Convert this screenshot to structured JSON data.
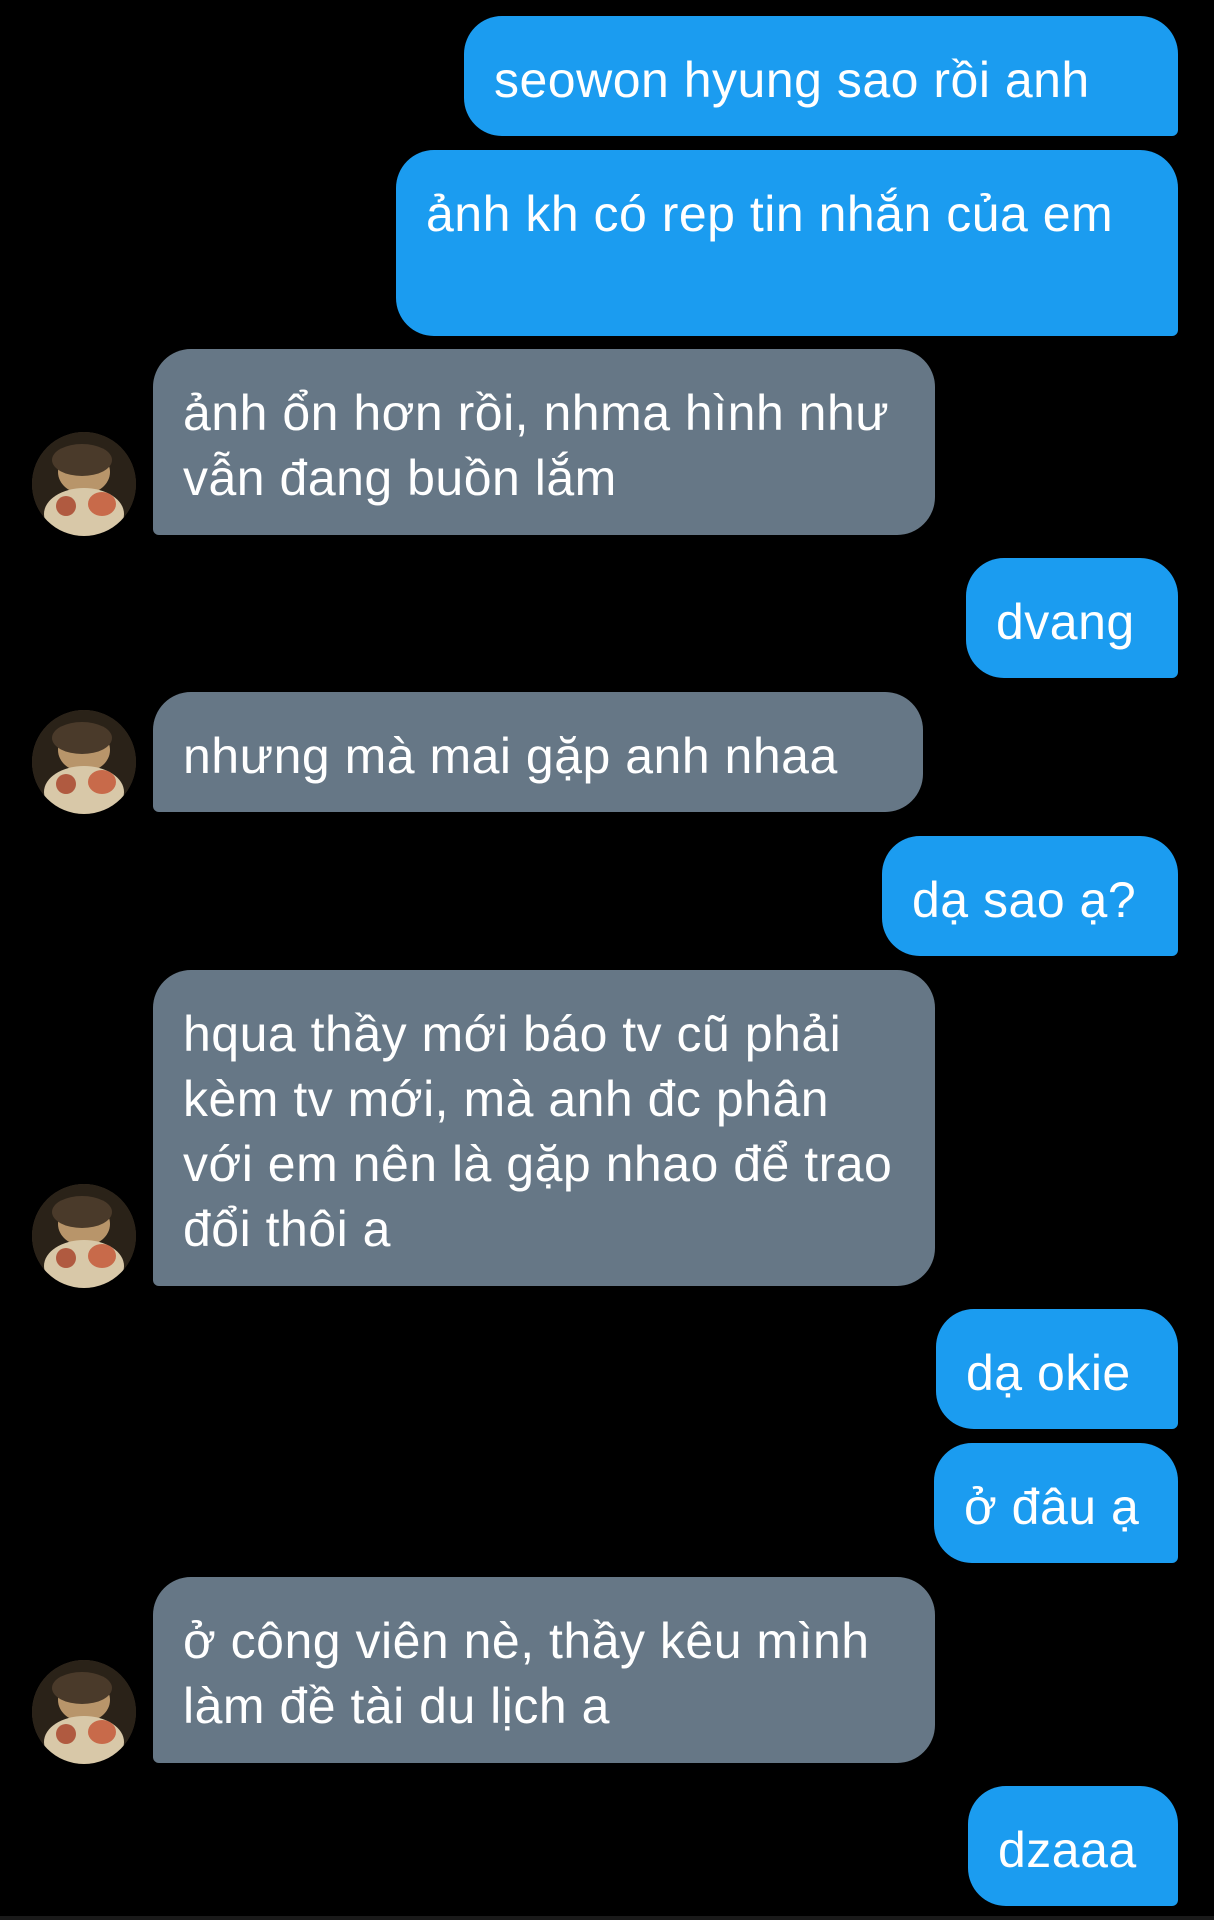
{
  "conversation": {
    "messages": [
      {
        "side": "sent",
        "text": "seowon hyung sao rồi anh"
      },
      {
        "side": "sent",
        "text": "ảnh kh có rep tin nhắn của em"
      },
      {
        "side": "received",
        "text": "ảnh ổn hơn rồi, nhma hình như vẫn đang buồn lắm"
      },
      {
        "side": "sent",
        "text": "dvang"
      },
      {
        "side": "received",
        "text": "nhưng mà mai gặp anh nhaa"
      },
      {
        "side": "sent",
        "text": "dạ sao ạ?"
      },
      {
        "side": "received",
        "text": "hqua thầy mới báo tv cũ phải kèm tv mới, mà anh đc phân với em nên là gặp nhao để trao đổi thôi a"
      },
      {
        "side": "sent",
        "text": "dạ okie"
      },
      {
        "side": "sent",
        "text": "ở đâu ạ"
      },
      {
        "side": "received",
        "text": "ở công viên nè, thầy kêu mình làm đề tài du lịch a"
      },
      {
        "side": "sent",
        "text": "dzaaa"
      }
    ]
  },
  "colors": {
    "background": "#000000",
    "sent_bubble": "#1b9cf0",
    "received_bubble": "#667786",
    "text": "#ffffff"
  },
  "icons": {
    "contact_avatar": "avatar-photo"
  }
}
